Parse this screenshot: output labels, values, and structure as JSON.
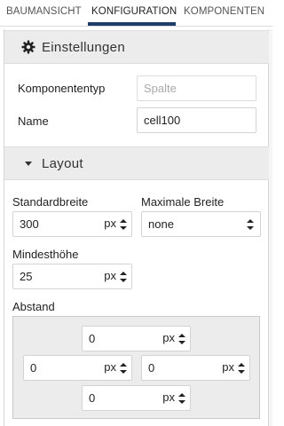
{
  "tabs": [
    {
      "label": "BAUMANSICHT",
      "active": false
    },
    {
      "label": "KONFIGURATION",
      "active": true
    },
    {
      "label": "KOMPONENTEN",
      "active": false
    }
  ],
  "settings": {
    "title": "Einstellungen",
    "icon": "gear-icon",
    "component_type_label": "Komponententyp",
    "component_type_value": "Spalte",
    "name_label": "Name",
    "name_value": "cell100"
  },
  "layout": {
    "title": "Layout",
    "icon": "caret-down-icon",
    "standard_width_label": "Standardbreite",
    "standard_width_value": "300",
    "standard_width_unit": "px",
    "max_width_label": "Maximale Breite",
    "max_width_value": "none",
    "min_height_label": "Mindesthöhe",
    "min_height_value": "25",
    "min_height_unit": "px",
    "spacing_label": "Abstand",
    "spacing": {
      "top": {
        "value": "0",
        "unit": "px"
      },
      "left": {
        "value": "0",
        "unit": "px"
      },
      "right": {
        "value": "0",
        "unit": "px"
      },
      "bottom": {
        "value": "0",
        "unit": "px"
      }
    }
  },
  "colors": {
    "accent": "#1f3d6b",
    "section_bg": "#ececec"
  }
}
